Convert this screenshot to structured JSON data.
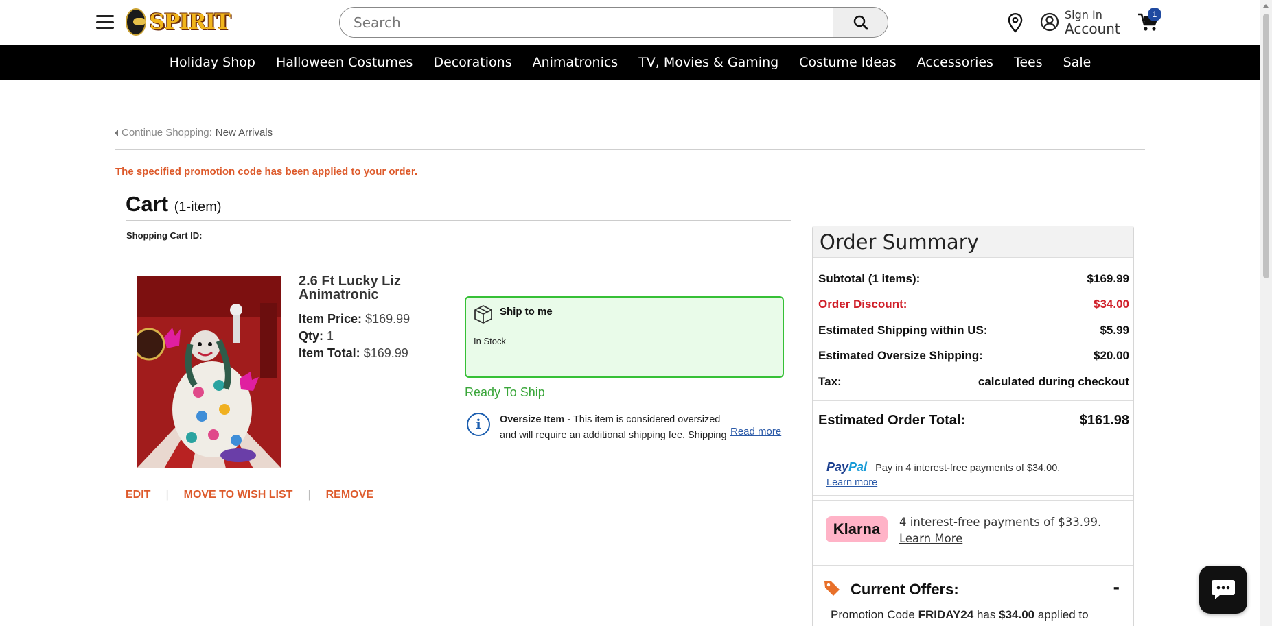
{
  "header": {
    "logo_text": "SPIRIT",
    "search_placeholder": "Search",
    "account_line1": "Sign In",
    "account_line2": "Account",
    "cart_count": "1"
  },
  "nav": [
    "Holiday Shop",
    "Halloween Costumes",
    "Decorations",
    "Animatronics",
    "TV, Movies & Gaming",
    "Costume Ideas",
    "Accessories",
    "Tees",
    "Sale"
  ],
  "breadcrumb": {
    "prefix": "Continue Shopping:",
    "link": "New Arrivals"
  },
  "promo_message": "The specified promotion code has been applied to your order.",
  "cart": {
    "title": "Cart",
    "count": "(1-item)",
    "cart_id_label": "Shopping Cart ID:"
  },
  "item": {
    "name": "2.6 Ft Lucky Liz Animatronic",
    "price_label": "Item Price:",
    "price": "$169.99",
    "qty_label": "Qty:",
    "qty": "1",
    "total_label": "Item Total:",
    "total": "$169.99",
    "ship_title": "Ship to me",
    "stock": "In Stock",
    "ready": "Ready To Ship",
    "oversize_label": "Oversize Item -",
    "oversize_text": "This item is considered oversized and will require an additional shipping fee. Shipping promo",
    "read_more": "Read more",
    "actions": {
      "edit": "EDIT",
      "wishlist": "MOVE TO WISH LIST",
      "remove": "REMOVE"
    }
  },
  "summary": {
    "title": "Order Summary",
    "rows": [
      {
        "label": "Subtotal (1 items):",
        "value": "$169.99"
      },
      {
        "label": "Order Discount:",
        "value": "$34.00"
      },
      {
        "label": "Estimated Shipping within US:",
        "value": "$5.99"
      },
      {
        "label": "Estimated Oversize Shipping:",
        "value": "$20.00"
      },
      {
        "label": "Tax:",
        "value": "calculated during checkout"
      }
    ],
    "total_label": "Estimated Order Total:",
    "total_value": "$161.98",
    "paypal_brand_a": "Pay",
    "paypal_brand_b": "Pal",
    "paypal_text": "Pay in 4 interest-free payments of $34.00.",
    "paypal_learn": "Learn more",
    "klarna_brand": "Klarna",
    "klarna_text": "4 interest-free payments of $33.99.",
    "klarna_learn": "Learn More",
    "offers_title": "Current Offers:",
    "offers_toggle": "-",
    "offer_prefix": "Promotion Code",
    "offer_code": "FRIDAY24",
    "offer_mid": "has",
    "offer_amount": "$34.00",
    "offer_suffix": "applied to"
  },
  "colors": {
    "accent_orange": "#dd5a2b",
    "discount_red": "#d0202a",
    "ship_green": "#3aa63a",
    "nav_black": "#000000"
  }
}
